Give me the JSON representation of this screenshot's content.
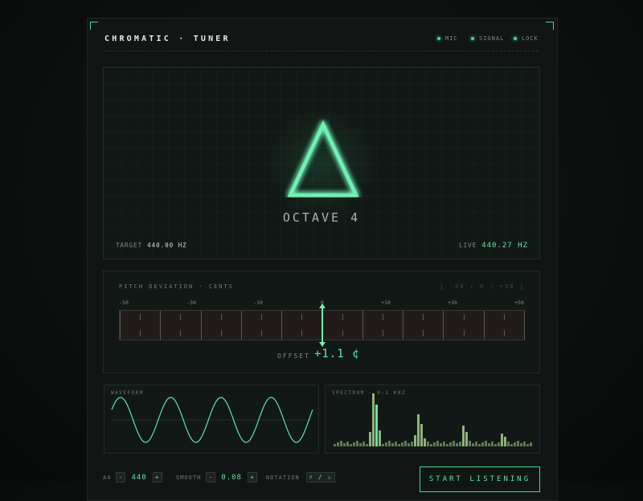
{
  "header": {
    "title": "CHROMATIC · TUNER",
    "indicators": [
      {
        "label": "MIC",
        "color": "#3ddc97"
      },
      {
        "label": "SIGNAL",
        "color": "#3ddc97"
      },
      {
        "label": "LOCK",
        "color": "#3ddc97"
      }
    ]
  },
  "hero": {
    "note_icon": "triangle-note-icon",
    "octave": "OCTAVE 4",
    "target_label": "TARGET",
    "target_value": "440.00 HZ",
    "live_label": "LIVE",
    "live_value": "440.27 HZ"
  },
  "deviation": {
    "title": "PITCH DEVIATION · CENTS",
    "range_text": "[ -50 / 0 / +50 ]",
    "ticks": [
      "-50",
      "-30",
      "-10",
      "0",
      "+10",
      "+30",
      "+50"
    ],
    "cents": 1.1,
    "offset_label": "OFFSET",
    "offset_value": "+1.1 ¢"
  },
  "waveform": {
    "title": "WAVEFORM"
  },
  "spectrum": {
    "title": "SPECTRUM · 0-2 KHZ"
  },
  "controls": {
    "a4_label": "A4",
    "a4_value": "440",
    "smooth_label": "SMOOTH",
    "smooth_value": "0.08",
    "notation_label": "NOTATION",
    "notation_value": "♯ / ♭",
    "minus": "-",
    "plus": "+",
    "start_button": "START LISTENING"
  },
  "colors": {
    "accent": "#3ddc97",
    "accent_text": "#5fe6a8"
  }
}
